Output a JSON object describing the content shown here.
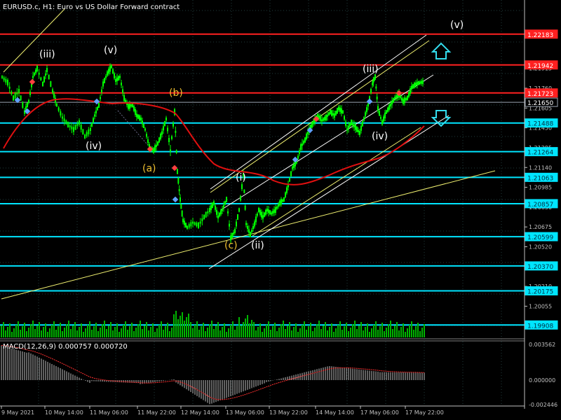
{
  "header": {
    "title": "EURUSD.c, H1:  Euro vs US Dollar Forward contract"
  },
  "macd": {
    "label": "MACD(12,26,9) 0.000757 0.000720",
    "ymin": -0.002446,
    "ymax": 0.003562
  },
  "price_axis": {
    "ymin": 1.198,
    "ymax": 1.2245,
    "ticks": [
      "1.21915",
      "1.21760",
      "1.21605",
      "1.21450",
      "1.21295",
      "1.21140",
      "1.20985",
      "1.20830",
      "1.20675",
      "1.20520",
      "1.20365",
      "1.20210",
      "1.20055"
    ],
    "tick_values": [
      1.21915,
      1.2176,
      1.21605,
      1.2145,
      1.21295,
      1.2114,
      1.20985,
      1.2083,
      1.20675,
      1.2052,
      1.20365,
      1.2021,
      1.20055
    ]
  },
  "macd_axis": {
    "ticks": [
      "0.003562",
      "0.000000",
      "-0.002446"
    ],
    "tick_values": [
      0.003562,
      0.0,
      -0.002446
    ]
  },
  "time_axis": {
    "labels": [
      "9 May 2021",
      "10 May 14:00",
      "11 May 06:00",
      "11 May 22:00",
      "12 May 14:00",
      "13 May 06:00",
      "13 May 22:00",
      "14 May 14:00",
      "17 May 06:00",
      "17 May 22:00"
    ]
  },
  "levels": [
    {
      "label": "1.22183",
      "value": 1.22183,
      "color": "#ff2020",
      "box": "#ff2020"
    },
    {
      "label": "1.21942",
      "value": 1.21942,
      "color": "#ff2020",
      "box": "#ff2020"
    },
    {
      "label": "1.21723",
      "value": 1.21723,
      "color": "#ff2020",
      "box": "#ff2020"
    },
    {
      "label": "1.21650",
      "value": 1.2165,
      "color": "#9aa4b0",
      "box": "#000000"
    },
    {
      "label": "1.21488",
      "value": 1.21488,
      "color": "#00e5ff",
      "box": "#00e5ff"
    },
    {
      "label": "1.21264",
      "value": 1.21264,
      "color": "#00e5ff",
      "box": "#00e5ff"
    },
    {
      "label": "1.21063",
      "value": 1.21063,
      "color": "#00e5ff",
      "box": "#00e5ff"
    },
    {
      "label": "1.20857",
      "value": 1.20857,
      "color": "#00e5ff",
      "box": "#00e5ff"
    },
    {
      "label": "1.20599",
      "value": 1.20599,
      "color": "#00e5ff",
      "box": "#00e5ff"
    },
    {
      "label": "1.20370",
      "value": 1.2037,
      "color": "#00e5ff",
      "box": "#00e5ff"
    },
    {
      "label": "1.20175",
      "value": 1.20175,
      "color": "#00e5ff",
      "box": "#00e5ff"
    },
    {
      "label": "1.19908",
      "value": 1.19908,
      "color": "#00e5ff",
      "box": "#00e5ff"
    }
  ],
  "wave_labels": [
    {
      "text": "(iii)",
      "color": "#ffffff"
    },
    {
      "text": "(v)",
      "color": "#ffffff"
    },
    {
      "text": "(iv)",
      "color": "#ffffff"
    },
    {
      "text": "(b)",
      "color": "#f0c030"
    },
    {
      "text": "(a)",
      "color": "#f0c030"
    },
    {
      "text": "(c)",
      "color": "#f0c030"
    },
    {
      "text": "(i)",
      "color": "#ffffff"
    },
    {
      "text": "(ii)",
      "color": "#ffffff"
    },
    {
      "text": "(iii)",
      "color": "#ffffff"
    },
    {
      "text": "(iv)",
      "color": "#ffffff"
    },
    {
      "text": "(v)",
      "color": "#ffffff"
    }
  ],
  "colors": {
    "candle": "#00ff00",
    "ma": "#e01010",
    "grid": "#1e3a3a",
    "trend": "#f0f070",
    "channel": "#ffffff",
    "arrow": "#33ddee",
    "volume": "#00b400",
    "macd_hist": "#c0c0c0",
    "macd_signal": "#ff3030"
  },
  "icons": {
    "up_arrow": "up-arrow-icon",
    "down_arrow": "down-arrow-icon"
  }
}
